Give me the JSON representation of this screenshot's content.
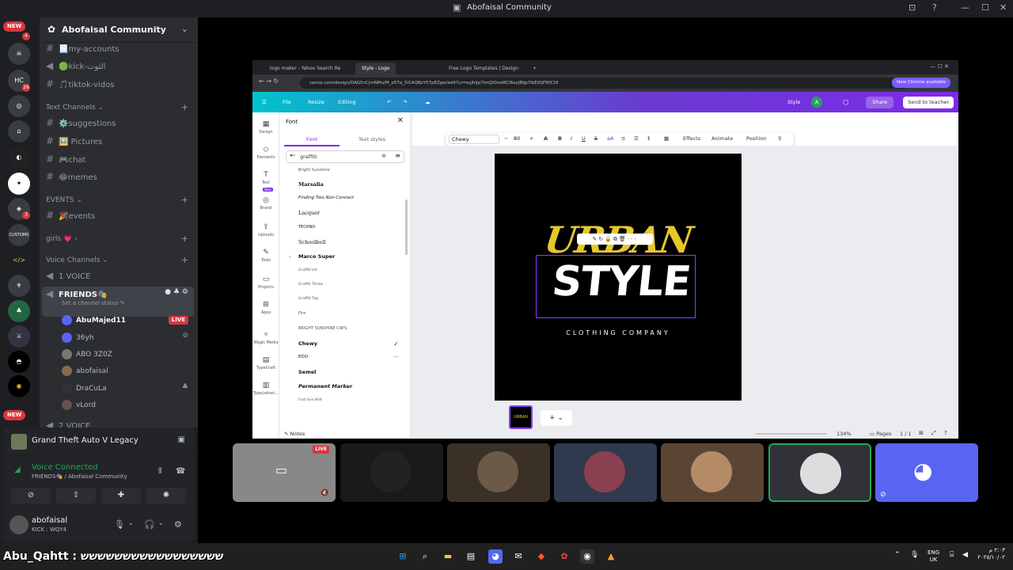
{
  "window": {
    "title": "Abofaisal Community"
  },
  "servers": {
    "new_top": "NEW",
    "new_bottom": "NEW",
    "badges": [
      "4",
      "26",
      "3"
    ],
    "labels": [
      "CUSTOMS",
      "</>"
    ]
  },
  "guild": {
    "name": "Abofaisal Community"
  },
  "channels": {
    "top": [
      {
        "label": "📃my-accounts"
      },
      {
        "label": "🟢kick-الثوت"
      },
      {
        "label": "🎵tiktok-vidos"
      }
    ],
    "text_category": "Text Channels",
    "text": [
      {
        "label": "⚙️suggestions"
      },
      {
        "label": "🖼️ Pictures"
      },
      {
        "label": "🎮chat"
      },
      {
        "label": "😂memes"
      }
    ],
    "events_category": "EVENTS",
    "events": [
      {
        "label": "🎉events"
      }
    ],
    "girls_category": "girls 💗",
    "voice_category": "Voice Channels",
    "voice": [
      {
        "label": "1 VOICE"
      }
    ],
    "friends": {
      "label": "FRIENDS🎭",
      "status": "Set a channel status"
    },
    "users": [
      {
        "name": "AbuMajed11",
        "live": "LIVE"
      },
      {
        "name": "36yh"
      },
      {
        "name": "ABO 3Z0Z"
      },
      {
        "name": "abofaisal"
      },
      {
        "name": "DraCuLa"
      },
      {
        "name": "vLord"
      }
    ],
    "voice2": "2 VOICE"
  },
  "panel": {
    "game": "Grand Theft Auto V Legacy",
    "voice_connected": "Voice Connected",
    "voice_sub": "FRIENDS🎭 / Abofaisal Community",
    "user_name": "abofaisal",
    "user_status": "KICK : WQY4"
  },
  "browser": {
    "tabs": [
      "logo maker - Yahoo Search Re",
      "Style - Logo",
      "Free Logo Templates | Design"
    ],
    "url": "canva.com/design/DAG5nCjmNMu/M_o57q_5I1AQNzY57pEZgw/edit?ui=eyJhIjp7ImQiOnsiRCI6eyJBIjp7IkEiOjF9fX19",
    "new_chrome": "New Chrome available"
  },
  "canva": {
    "file": "File",
    "resize": "Resize",
    "editing": "Editing",
    "style_label": "Style",
    "avatar": "A",
    "share": "Share",
    "send_teacher": "Send to teacher",
    "rail": [
      "Design",
      "Elements",
      "Text",
      "Brand",
      "Uploads",
      "Tools",
      "Projects",
      "Apps",
      "Magic Media",
      "TypeCraft",
      "TypeLetteri..."
    ],
    "new_badge": "New",
    "font_panel": {
      "title": "Font",
      "tab_font": "Font",
      "tab_styles": "Text styles",
      "search": "graffiti",
      "fonts": [
        "Bright Sunshine",
        "Marsalia",
        "Finding Two Non-Connect",
        "Lacquer",
        "TECHNO",
        "Schoolbell",
        "Marco Super",
        "Graffiti Ink",
        "Graffiti Throw",
        "Graffiti Tag",
        "Fire",
        "BRIGHT SUNSHINE CAPS",
        "Chewy",
        "EDO",
        "Semel",
        "Permanent Marker",
        "Fast Sun Bolt"
      ]
    },
    "toolbar": {
      "font": "Chewy",
      "size": "80",
      "effects": "Effects",
      "animate": "Animate",
      "position": "Position"
    },
    "art": {
      "line1": "URBAN",
      "line2": "STYLE",
      "line3": "CLOTHING COMPANY"
    },
    "footer": {
      "notes": "Notes",
      "zoom": "134%",
      "pages": "Pages",
      "page_count": "1 / 1"
    }
  },
  "tiles": {
    "live": "LIVE"
  },
  "taskbar": {
    "overlay": "Abu_Qahtt : ששששששששששששששששש",
    "lang": "ENG",
    "region": "UK",
    "time": "٢:٠٣ م",
    "date": "٢٠٢٥/١٠/٠٢"
  },
  "colors": {
    "discord_bg": "#1e1f22",
    "channel_bg": "#2b2d31",
    "accent": "#5865f2",
    "green": "#23a55a",
    "red": "#da373c",
    "canva_purple": "#7d2ae8",
    "urban_yellow": "#e6c82a"
  }
}
